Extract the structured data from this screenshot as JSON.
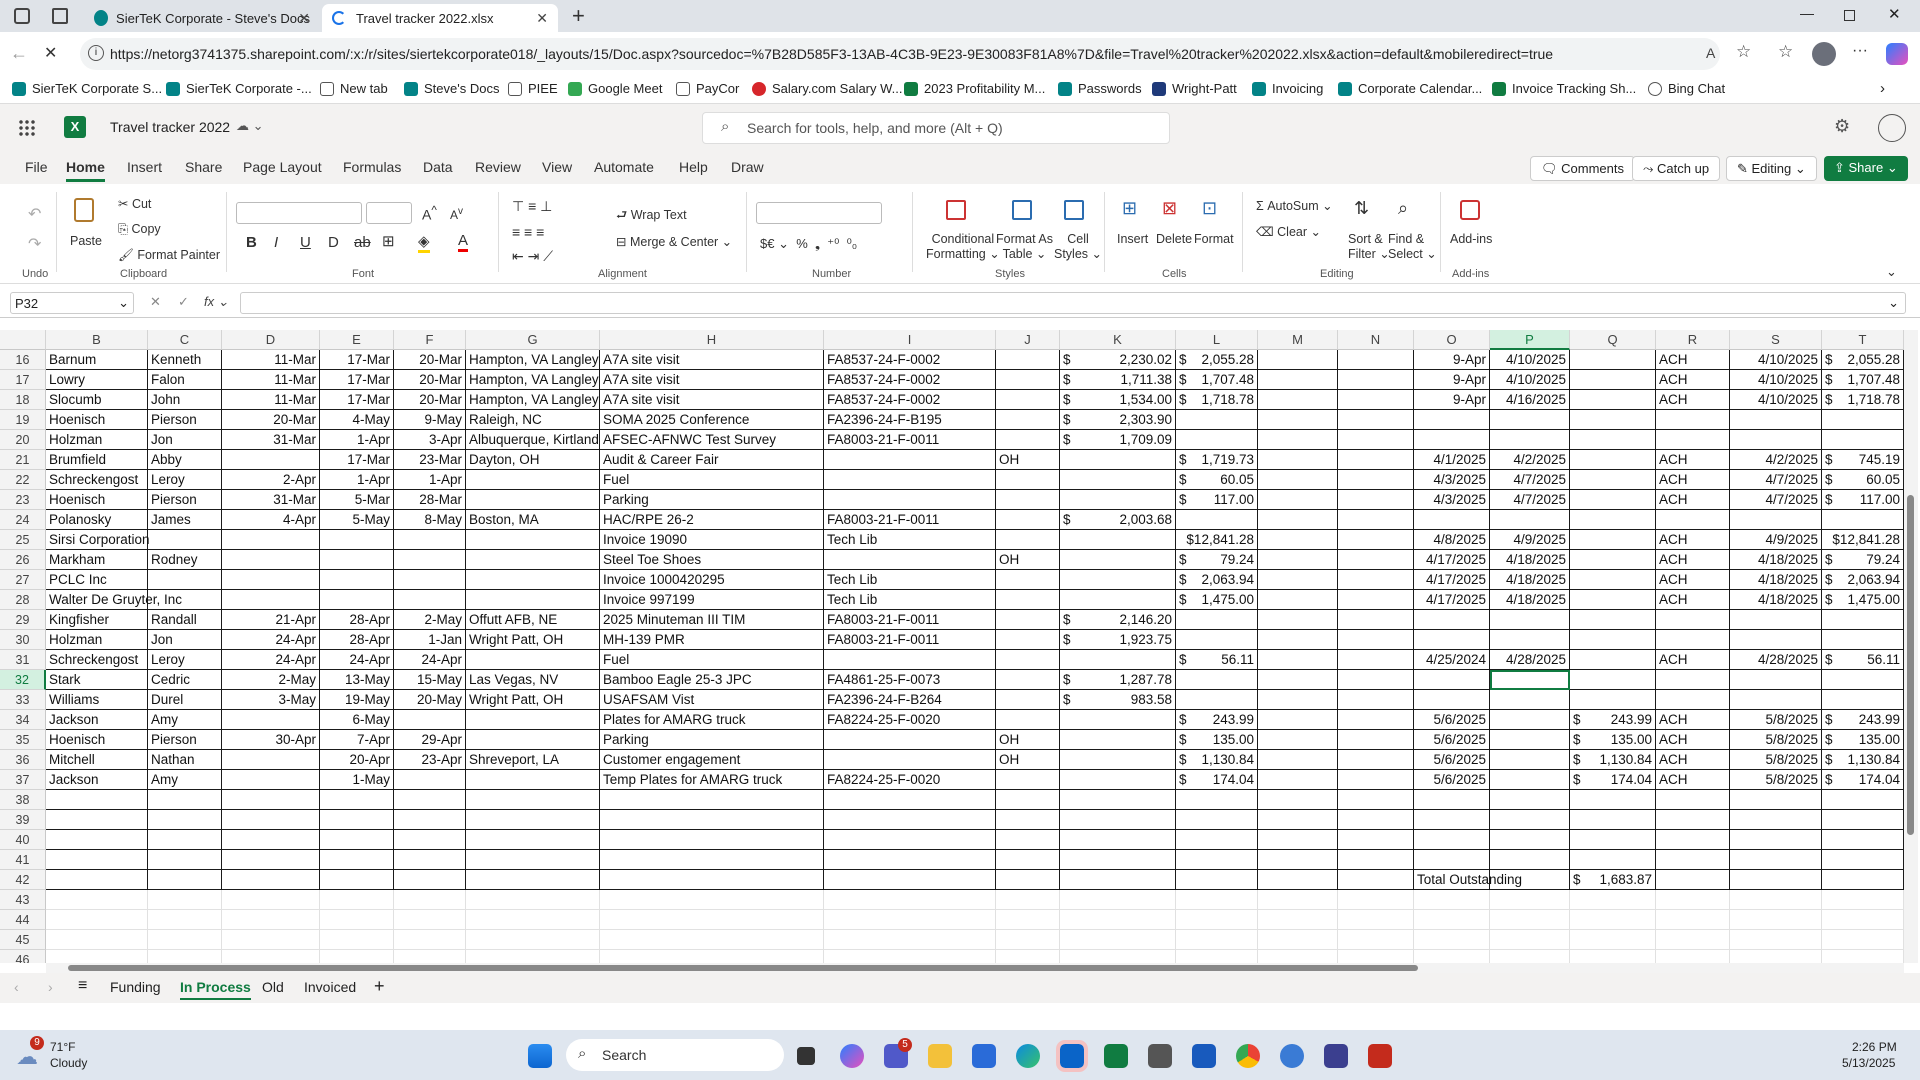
{
  "browser": {
    "tabs": [
      {
        "label": "SierTeK Corporate - Steve's Docs"
      },
      {
        "label": "Travel tracker 2022.xlsx"
      }
    ],
    "url": "https://netorg3741375.sharepoint.com/:x:/r/sites/siertekcorporate018/_layouts/15/Doc.aspx?sourcedoc=%7B28D585F3-13AB-4C3B-9E23-9E30083F81A8%7D&file=Travel%20tracker%202022.xlsx&action=default&mobileredirect=true",
    "favorites": [
      "SierTeK Corporate S...",
      "SierTeK Corporate -...",
      "New tab",
      "Steve's Docs",
      "PIEE",
      "Google Meet",
      "PayCor",
      "Salary.com Salary W...",
      "2023 Profitability M...",
      "Passwords",
      "Wright-Patt",
      "Invoicing",
      "Corporate Calendar...",
      "Invoice Tracking Sh...",
      "Bing Chat"
    ]
  },
  "app": {
    "title": "Travel tracker 2022",
    "search_placeholder": "Search for tools, help, and more (Alt + Q)"
  },
  "menu": {
    "items": [
      "File",
      "Home",
      "Insert",
      "Share",
      "Page Layout",
      "Formulas",
      "Data",
      "Review",
      "View",
      "Automate",
      "Help",
      "Draw"
    ],
    "comments": "Comments",
    "catchup": "Catch up",
    "editing": "Editing",
    "share": "Share"
  },
  "ribbon": {
    "undo": "Undo",
    "paste": "Paste",
    "cut": "Cut",
    "copy": "Copy",
    "format_painter": "Format Painter",
    "clipboard": "Clipboard",
    "font": "Font",
    "wrap_text": "Wrap Text",
    "merge_center": "Merge & Center",
    "alignment": "Alignment",
    "number": "Number",
    "conditional": "Conditional",
    "formatting": "Formatting",
    "format_as": "Format As",
    "table": "Table",
    "cell": "Cell",
    "styles_l": "Styles",
    "styles": "Styles",
    "insert": "Insert",
    "delete": "Delete",
    "format": "Format",
    "cells": "Cells",
    "autosum": "AutoSum",
    "clear": "Clear",
    "sort": "Sort &",
    "filter": "Filter",
    "find": "Find &",
    "select": "Select",
    "editing": "Editing",
    "addins": "Add-ins",
    "addins_grp": "Add-ins"
  },
  "formula_bar": {
    "name_box": "P32",
    "content": ""
  },
  "sheet": {
    "columns": [
      "B",
      "C",
      "D",
      "E",
      "F",
      "G",
      "H",
      "I",
      "J",
      "K",
      "L",
      "M",
      "N",
      "O",
      "P",
      "Q",
      "R",
      "S",
      "T"
    ],
    "row_numbers": [
      "16",
      "17",
      "18",
      "19",
      "20",
      "21",
      "22",
      "23",
      "24",
      "25",
      "26",
      "27",
      "28",
      "29",
      "30",
      "31",
      "32",
      "33",
      "34",
      "35",
      "36",
      "37",
      "38",
      "39",
      "40",
      "41",
      "42",
      "43",
      "44",
      "45",
      "46"
    ],
    "rows": [
      [
        "Barnum",
        "Kenneth",
        "11-Mar",
        "17-Mar",
        "20-Mar",
        "Hampton, VA Langley",
        "A7A site visit",
        "FA8537-24-F-0002",
        "",
        "2,230.02",
        "2,055.28",
        "",
        "",
        "9-Apr",
        "4/10/2025",
        "",
        "ACH",
        "4/10/2025",
        "2,055.28"
      ],
      [
        "Lowry",
        "Falon",
        "11-Mar",
        "17-Mar",
        "20-Mar",
        "Hampton, VA Langley",
        "A7A site visit",
        "FA8537-24-F-0002",
        "",
        "1,711.38",
        "1,707.48",
        "",
        "",
        "9-Apr",
        "4/10/2025",
        "",
        "ACH",
        "4/10/2025",
        "1,707.48"
      ],
      [
        "Slocumb",
        "John",
        "11-Mar",
        "17-Mar",
        "20-Mar",
        "Hampton, VA Langley",
        "A7A site visit",
        "FA8537-24-F-0002",
        "",
        "1,534.00",
        "1,718.78",
        "",
        "",
        "9-Apr",
        "4/16/2025",
        "",
        "ACH",
        "4/10/2025",
        "1,718.78"
      ],
      [
        "Hoenisch",
        "Pierson",
        "20-Mar",
        "4-May",
        "9-May",
        "Raleigh, NC",
        "SOMA 2025 Conference",
        "FA2396-24-F-B195",
        "",
        "2,303.90",
        "",
        "",
        "",
        "",
        "",
        "",
        "",
        "",
        ""
      ],
      [
        "Holzman",
        "Jon",
        "31-Mar",
        "1-Apr",
        "3-Apr",
        "Albuquerque, Kirtland",
        "AFSEC-AFNWC Test Survey",
        "FA8003-21-F-0011",
        "",
        "1,709.09",
        "",
        "",
        "",
        "",
        "",
        "",
        "",
        "",
        ""
      ],
      [
        "Brumfield",
        "Abby",
        "",
        "17-Mar",
        "23-Mar",
        "Dayton, OH",
        "Audit & Career Fair",
        "",
        "OH",
        "",
        "1,719.73",
        "",
        "",
        "4/1/2025",
        "4/2/2025",
        "",
        "ACH",
        "4/2/2025",
        "745.19"
      ],
      [
        "Schreckengost",
        "Leroy",
        "2-Apr",
        "1-Apr",
        "1-Apr",
        "",
        "Fuel",
        "",
        "",
        "",
        "60.05",
        "",
        "",
        "4/3/2025",
        "4/7/2025",
        "",
        "ACH",
        "4/7/2025",
        "60.05"
      ],
      [
        "Hoenisch",
        "Pierson",
        "31-Mar",
        "5-Mar",
        "28-Mar",
        "",
        "Parking",
        "",
        "",
        "",
        "117.00",
        "",
        "",
        "4/3/2025",
        "4/7/2025",
        "",
        "ACH",
        "4/7/2025",
        "117.00"
      ],
      [
        "Polanosky",
        "James",
        "4-Apr",
        "5-May",
        "8-May",
        "Boston, MA",
        "HAC/RPE 26-2",
        "FA8003-21-F-0011",
        "",
        "2,003.68",
        "",
        "",
        "",
        "",
        "",
        "",
        "",
        "",
        ""
      ],
      [
        "Sirsi Corporation",
        "",
        "",
        "",
        "",
        "",
        "Invoice 19090",
        "Tech Lib",
        "",
        "",
        "$12,841.28",
        "",
        "",
        "4/8/2025",
        "4/9/2025",
        "",
        "ACH",
        "4/9/2025",
        "$12,841.28"
      ],
      [
        "Markham",
        "Rodney",
        "",
        "",
        "",
        "",
        "Steel Toe Shoes",
        "",
        "OH",
        "",
        "79.24",
        "",
        "",
        "4/17/2025",
        "4/18/2025",
        "",
        "ACH",
        "4/18/2025",
        "79.24"
      ],
      [
        "PCLC Inc",
        "",
        "",
        "",
        "",
        "",
        "Invoice 1000420295",
        "Tech Lib",
        "",
        "",
        "2,063.94",
        "",
        "",
        "4/17/2025",
        "4/18/2025",
        "",
        "ACH",
        "4/18/2025",
        "2,063.94"
      ],
      [
        "Walter De Gruyter, Inc",
        "",
        "",
        "",
        "",
        "",
        "Invoice 997199",
        "Tech Lib",
        "",
        "",
        "1,475.00",
        "",
        "",
        "4/17/2025",
        "4/18/2025",
        "",
        "ACH",
        "4/18/2025",
        "1,475.00"
      ],
      [
        "Kingfisher",
        "Randall",
        "21-Apr",
        "28-Apr",
        "2-May",
        "Offutt AFB, NE",
        "2025 Minuteman III TIM",
        "FA8003-21-F-0011",
        "",
        "2,146.20",
        "",
        "",
        "",
        "",
        "",
        "",
        "",
        "",
        ""
      ],
      [
        "Holzman",
        "Jon",
        "24-Apr",
        "28-Apr",
        "1-Jan",
        "Wright Patt, OH",
        "MH-139 PMR",
        "FA8003-21-F-0011",
        "",
        "1,923.75",
        "",
        "",
        "",
        "",
        "",
        "",
        "",
        "",
        ""
      ],
      [
        "Schreckengost",
        "Leroy",
        "24-Apr",
        "24-Apr",
        "24-Apr",
        "",
        "Fuel",
        "",
        "",
        "",
        "56.11",
        "",
        "",
        "4/25/2024",
        "4/28/2025",
        "",
        "ACH",
        "4/28/2025",
        "56.11"
      ],
      [
        "Stark",
        "Cedric",
        "2-May",
        "13-May",
        "15-May",
        "Las Vegas, NV",
        "Bamboo Eagle 25-3 JPC",
        "FA4861-25-F-0073",
        "",
        "1,287.78",
        "",
        "",
        "",
        "",
        "",
        "",
        "",
        "",
        ""
      ],
      [
        "Williams",
        "Durel",
        "3-May",
        "19-May",
        "20-May",
        "Wright Patt, OH",
        "USAFSAM Vist",
        "FA2396-24-F-B264",
        "",
        "983.58",
        "",
        "",
        "",
        "",
        "",
        "",
        "",
        "",
        ""
      ],
      [
        "Jackson",
        "Amy",
        "",
        "6-May",
        "",
        "",
        "Plates for AMARG truck",
        "FA8224-25-F-0020",
        "",
        "",
        "243.99",
        "",
        "",
        "5/6/2025",
        "",
        "243.99",
        "ACH",
        "5/8/2025",
        "243.99"
      ],
      [
        "Hoenisch",
        "Pierson",
        "30-Apr",
        "7-Apr",
        "29-Apr",
        "",
        "Parking",
        "",
        "OH",
        "",
        "135.00",
        "",
        "",
        "5/6/2025",
        "",
        "135.00",
        "ACH",
        "5/8/2025",
        "135.00"
      ],
      [
        "Mitchell",
        "Nathan",
        "",
        "20-Apr",
        "23-Apr",
        "Shreveport, LA",
        "Customer engagement",
        "",
        "OH",
        "",
        "1,130.84",
        "",
        "",
        "5/6/2025",
        "",
        "1,130.84",
        "ACH",
        "5/8/2025",
        "1,130.84"
      ],
      [
        "Jackson",
        "Amy",
        "",
        "1-May",
        "",
        "",
        "Temp Plates for AMARG truck",
        "FA8224-25-F-0020",
        "",
        "",
        "174.04",
        "",
        "",
        "5/6/2025",
        "",
        "174.04",
        "ACH",
        "5/8/2025",
        "174.04"
      ]
    ],
    "total_label": "Total Outstanding",
    "total_value": "1,683.87",
    "currency": "$",
    "tabs": [
      "Funding",
      "In Process",
      "Old",
      "Invoiced"
    ],
    "active_tab": "In Process"
  },
  "taskbar": {
    "weather_temp": "71°F",
    "weather_desc": "Cloudy",
    "weather_badge": "9",
    "search": "Search",
    "teams_badge": "5",
    "time": "2:26 PM",
    "date": "5/13/2025"
  }
}
